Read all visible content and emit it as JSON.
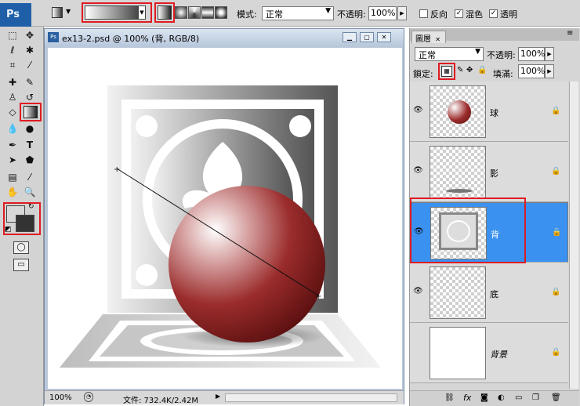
{
  "app": {
    "logo": "Ps"
  },
  "options": {
    "mode_label": "模式:",
    "mode_value": "正常",
    "opacity_label": "不透明:",
    "opacity_value": "100%",
    "reverse_label": "反向",
    "dither_label": "混色",
    "transparency_label": "透明"
  },
  "document": {
    "title": "ex13-2.psd @ 100% (背, RGB/8)",
    "zoom": "100%",
    "file_info": "文件: 732.4K/2.42M"
  },
  "layers_panel": {
    "tab": "圖層",
    "blend_mode": "正常",
    "opacity_label": "不透明:",
    "opacity_value": "100%",
    "lock_label": "鎖定:",
    "fill_label": "填滿:",
    "fill_value": "100%",
    "layers": [
      {
        "name": "球"
      },
      {
        "name": "影"
      },
      {
        "name": "背"
      },
      {
        "name": "底"
      },
      {
        "name": "背景"
      }
    ],
    "selected_index": 2
  },
  "colors": {
    "accent_red": "#e01b22",
    "selection_blue": "#3a91f0",
    "sphere": "#9b2c2c"
  }
}
